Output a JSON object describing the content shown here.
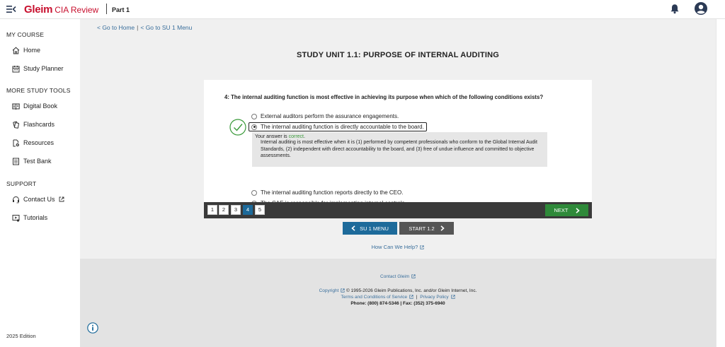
{
  "header": {
    "brand": "Gleim",
    "product": "CIA Review",
    "part": "Part 1",
    "icons": {
      "menu": "menu-collapse-icon",
      "bell": "bell-icon",
      "account": "account-circle-icon"
    }
  },
  "sidebar": {
    "sections": [
      {
        "heading": "MY COURSE",
        "items": [
          {
            "label": "Home",
            "icon": "home-icon"
          },
          {
            "label": "Study Planner",
            "icon": "calendar-icon"
          }
        ]
      },
      {
        "heading": "MORE STUDY TOOLS",
        "items": [
          {
            "label": "Digital Book",
            "icon": "book-icon"
          },
          {
            "label": "Flashcards",
            "icon": "flashcards-icon"
          },
          {
            "label": "Resources",
            "icon": "resources-icon"
          },
          {
            "label": "Test Bank",
            "icon": "test-bank-icon"
          }
        ]
      },
      {
        "heading": "SUPPORT",
        "items": [
          {
            "label": "Contact Us",
            "icon": "contact-icon"
          },
          {
            "label": "Tutorials",
            "icon": "tutorials-icon"
          }
        ]
      }
    ],
    "edition": "2025 Edition"
  },
  "breadcrumbs": {
    "home": "< Go to Home",
    "menu": "< Go to SU 1 Menu",
    "separator": "|"
  },
  "unit_title": "STUDY UNIT 1.1: PURPOSE OF INTERNAL AUDITING",
  "question": {
    "text": "4: The internal auditing function is most effective in achieving its purpose when which of the following conditions exists?",
    "options": [
      {
        "label": "External auditors perform the assurance engagements.",
        "selected": false
      },
      {
        "label": "The internal auditing function is directly accountable to the board.",
        "selected": true
      },
      {
        "label": "The internal auditing function reports directly to the CEO.",
        "selected": false
      },
      {
        "label": "The CAE is responsible for implementing internal controls.",
        "selected": false
      }
    ],
    "feedback": {
      "prefix": "Your answer is ",
      "status": "correct",
      "suffix": ".",
      "explanation": "Internal auditing is most effective when it is (1) performed by competent professionals who conform to the Global Internal Audit Standards, (2) independent with direct accountability to the board, and (3) free of undue influence and committed to objective assessments."
    }
  },
  "pager": {
    "pages": [
      "1",
      "2",
      "3",
      "4",
      "5"
    ],
    "current": "4",
    "next_label": "NEXT"
  },
  "nav_buttons": {
    "back": "SU 1 MENU",
    "forward": "START 1.2"
  },
  "help_link": "How Can We Help?",
  "footer": {
    "contact": "Contact Gleim",
    "copyright_link": "Copyright",
    "copyright_text": "© 1995-2026 Gleim Publications, Inc. and/or Gleim Internet, Inc.",
    "terms": "Terms and Conditions of Service",
    "privacy": "Privacy Policy",
    "separator": "|",
    "phone": "Phone: (800) 874-5346 | Fax: (352) 375-6940"
  },
  "colors": {
    "brand_red": "#c8102e",
    "link_blue": "#3a6f9c",
    "primary_blue": "#1d6a9a",
    "next_green": "#2f8a3a",
    "correct_green": "#3a9a3a"
  }
}
